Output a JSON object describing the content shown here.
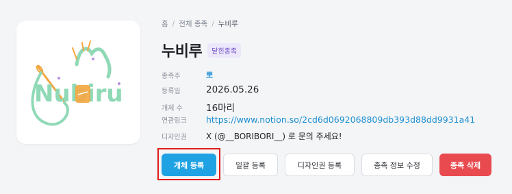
{
  "breadcrumb": {
    "home": "홈",
    "all_species": "전체 종족",
    "current": "누비루"
  },
  "title": "누비루",
  "badge": "닫힌종족",
  "logo": {
    "text": "Nubiru",
    "colors": {
      "mint": "#8fd9b6",
      "orange": "#f4a640",
      "purple": "#b98ee0"
    }
  },
  "details": {
    "owner": {
      "label": "종족주",
      "value": "뽀"
    },
    "registered": {
      "label": "등록일",
      "value": "2026.05.26"
    },
    "count": {
      "label": "개체 수",
      "value": "16마리"
    },
    "link": {
      "label": "연관링크",
      "value": "https://www.notion.so/2cd6d0692068809db393d88dd9931a41"
    },
    "design": {
      "label": "디자인권",
      "value": "X (@__BORIBORI__) 로 문의 주세요!"
    }
  },
  "actions": {
    "register_individual": "개체 등록",
    "bulk_register": "일괄 등록",
    "design_rights_register": "디자인권 등록",
    "edit_species_info": "종족 정보 수정",
    "delete_species": "종족 삭제"
  },
  "colors": {
    "primary": "#1ea2e4",
    "danger": "#e84a4f",
    "link": "#1c8fd0",
    "highlight": "#e01b1b"
  }
}
